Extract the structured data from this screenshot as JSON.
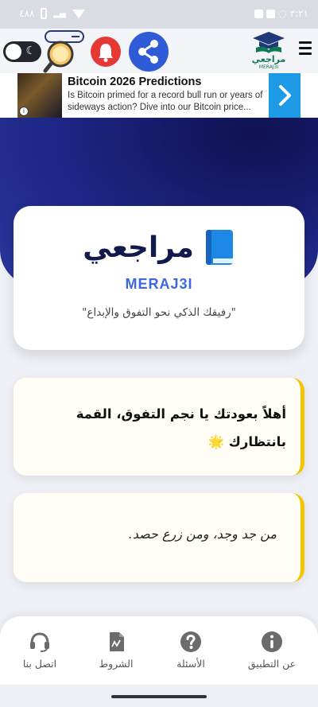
{
  "status_bar": {
    "left_text": "٤٨٨",
    "time": "٣:٢١"
  },
  "header": {
    "logo_text": "مراجعي",
    "logo_sub": "MERAJ3I"
  },
  "ad": {
    "title": "Bitcoin 2026 Predictions",
    "description": "Is Bitcoin primed for a record bull run or years of sideways action? Dive into our Bitcoin price...",
    "info_glyph": "i"
  },
  "brand": {
    "title": "مراجعي",
    "latin": "MERAJ3I",
    "tagline": "\"رفيقك الذكي نحو التفوق والإبداع\""
  },
  "welcome": {
    "text": "أهلاً بعودتك يا نجم التفوق، القمة بانتظارك 🌟"
  },
  "quote": {
    "text": "من جد وجد، ومن زرع حصد."
  },
  "nav": {
    "about": "عن التطبيق",
    "faq": "الأسئلة",
    "terms": "الشروط",
    "contact": "اتصل بنا"
  },
  "colors": {
    "hero": "#1d2685",
    "accent_blue": "#3b68e0",
    "share": "#2f5bd7",
    "bell": "#e53935",
    "card_border": "#f5c400",
    "ad_arrow": "#1e9be6"
  },
  "icons": {
    "toggle": "moon-icon",
    "search": "magnifier-icon",
    "bell": "bell-icon",
    "share": "share-icon",
    "menu": "hamburger-icon",
    "about": "info-icon",
    "faq": "question-icon",
    "terms": "document-icon",
    "contact": "headset-icon"
  }
}
